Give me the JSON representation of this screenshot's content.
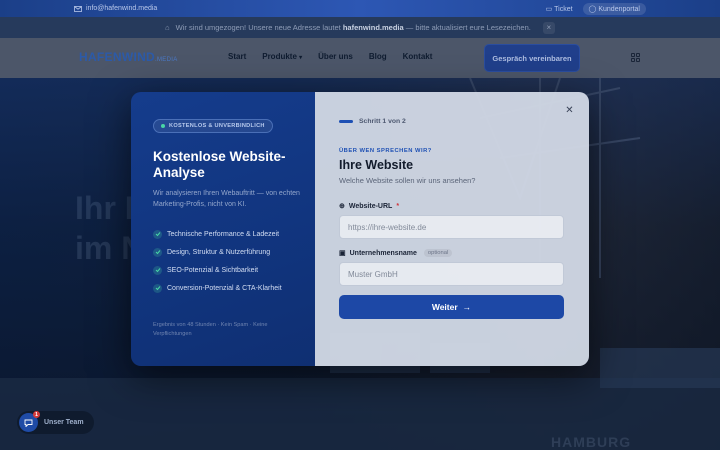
{
  "topbar": {
    "email": "info@hafenwind.media",
    "ticket_label": "Ticket",
    "portal_label": "Kundenportal"
  },
  "notice": {
    "text_before": "Wir sind umgezogen! Unsere neue Adresse lautet",
    "domain": "hafenwind.media",
    "text_after": "— bitte aktualisiert eure Lesezeichen."
  },
  "header": {
    "logo_text": "HAFENWIND",
    "logo_suffix": ".MEDIA",
    "nav": [
      "Start",
      "Produkte",
      "Über uns",
      "Blog",
      "Kontakt"
    ],
    "cta_label": "Gespräch vereinbaren"
  },
  "hero": {
    "title_line1": "Ihr Partner",
    "title_line2": "im Norden",
    "bottom_text": "HAMBURG"
  },
  "modal": {
    "left": {
      "badge": "KOSTENLOS & UNVERBINDLICH",
      "title": "Kostenlose Website-Analyse",
      "description": "Wir analysieren Ihren Webauftritt — von echten Marketing-Profis, nicht von KI.",
      "checks": [
        "Technische Performance & Ladezeit",
        "Design, Struktur & Nutzerführung",
        "SEO-Potenzial & Sichtbarkeit",
        "Conversion-Potenzial & CTA-Klarheit"
      ],
      "footnote": "Ergebnis von 48 Stunden · Kein Spam · Keine Verpflichtungen"
    },
    "right": {
      "step_label": "Schritt 1 von 2",
      "eyebrow": "ÜBER WEN SPRECHEN WIR?",
      "title": "Ihre Website",
      "subtitle": "Welche Website sollen wir uns ansehen?",
      "url_label": "Website-URL",
      "url_required": "*",
      "url_placeholder": "https://ihre-website.de",
      "company_label": "Unternehmensname",
      "company_optional": "optional",
      "company_placeholder": "Muster GmbH",
      "submit_label": "Weiter"
    }
  },
  "chat": {
    "label": "Unser Team",
    "count": "1"
  },
  "colors": {
    "accent": "#1d48a6",
    "check": "#49d6a6",
    "required": "#d0343b"
  }
}
